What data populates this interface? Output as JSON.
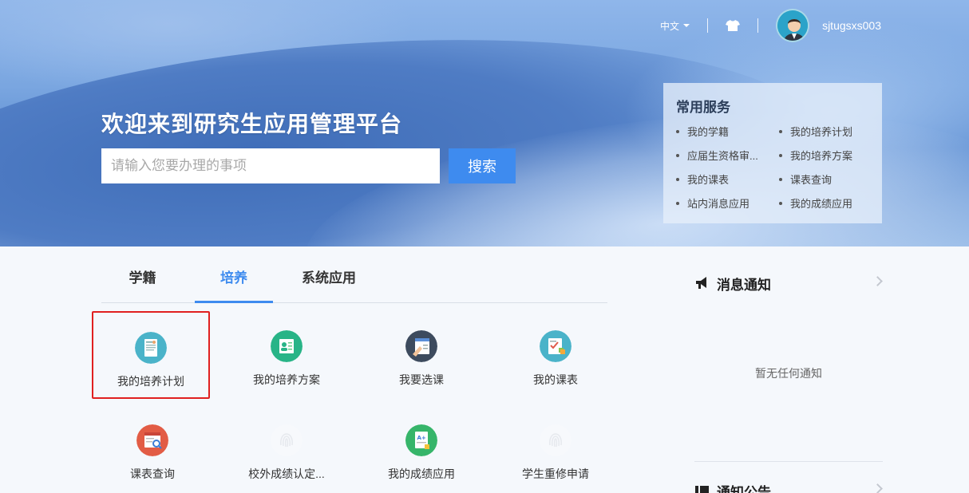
{
  "topbar": {
    "language": "中文",
    "username": "sjtugsxs003"
  },
  "hero": {
    "title": "欢迎来到研究生应用管理平台",
    "search_placeholder": "请输入您要办理的事项",
    "search_button": "搜索"
  },
  "services": {
    "title": "常用服务",
    "items": [
      "我的学籍",
      "我的培养计划",
      "应届生资格审...",
      "我的培养方案",
      "我的课表",
      "课表查询",
      "站内消息应用",
      "我的成绩应用"
    ]
  },
  "tabs": [
    {
      "label": "学籍"
    },
    {
      "label": "培养",
      "active": true
    },
    {
      "label": "系统应用"
    }
  ],
  "apps": [
    {
      "label": "我的培养计划",
      "icon": "study-plan-icon",
      "selected": true
    },
    {
      "label": "我的培养方案",
      "icon": "training-program-icon"
    },
    {
      "label": "我要选课",
      "icon": "course-selection-icon"
    },
    {
      "label": "我的课表",
      "icon": "timetable-icon"
    },
    {
      "label": "课表查询",
      "icon": "timetable-search-icon"
    },
    {
      "label": "校外成绩认定...",
      "icon": "fingerprint-icon"
    },
    {
      "label": "我的成绩应用",
      "icon": "grade-report-icon"
    },
    {
      "label": "学生重修申请",
      "icon": "fingerprint-icon"
    }
  ],
  "notices": {
    "title": "消息通知",
    "empty_text": "暂无任何通知"
  },
  "announcements": {
    "title": "通知公告"
  },
  "colors": {
    "accent": "#3e8bef",
    "selected_border": "#e02020"
  }
}
